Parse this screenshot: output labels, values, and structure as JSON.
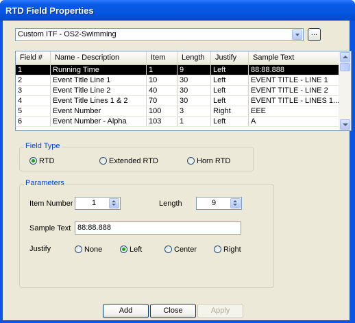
{
  "window": {
    "title": "RTD Field Properties"
  },
  "template_combo": {
    "selected": "Custom ITF - OS2-Swimming",
    "ellipsis_label": "..."
  },
  "table": {
    "headers": [
      "Field #",
      "Name - Description",
      "Item",
      "Length",
      "Justify",
      "Sample Text"
    ],
    "rows": [
      [
        "1",
        "Running Time",
        "1",
        "9",
        "Left",
        "88:88.888"
      ],
      [
        "2",
        "Event Title Line 1",
        "10",
        "30",
        "Left",
        "EVENT TITLE - LINE 1"
      ],
      [
        "3",
        "Event Title Line 2",
        "40",
        "30",
        "Left",
        "EVENT TITLE - LINE 2"
      ],
      [
        "4",
        "Event Title Lines 1 & 2",
        "70",
        "30",
        "Left",
        "EVENT TITLE - LINES 1..."
      ],
      [
        "5",
        "Event Number",
        "100",
        "3",
        "Right",
        "EEE"
      ],
      [
        "6",
        "Event Number - Alpha",
        "103",
        "1",
        "Left",
        "A"
      ]
    ],
    "selected_row": 0
  },
  "field_type": {
    "label": "Field Type",
    "options": [
      "RTD",
      "Extended RTD",
      "Horn RTD"
    ],
    "selected": "RTD"
  },
  "parameters": {
    "label": "Parameters",
    "item_number_label": "Item Number",
    "item_number": "1",
    "length_label": "Length",
    "length": "9",
    "sample_text_label": "Sample Text",
    "sample_text": "88:88.888",
    "justify_label": "Justify",
    "justify_options": [
      "None",
      "Left",
      "Center",
      "Right"
    ],
    "justify_selected": "Left"
  },
  "buttons": {
    "add": "Add",
    "close": "Close",
    "apply": "Apply"
  }
}
